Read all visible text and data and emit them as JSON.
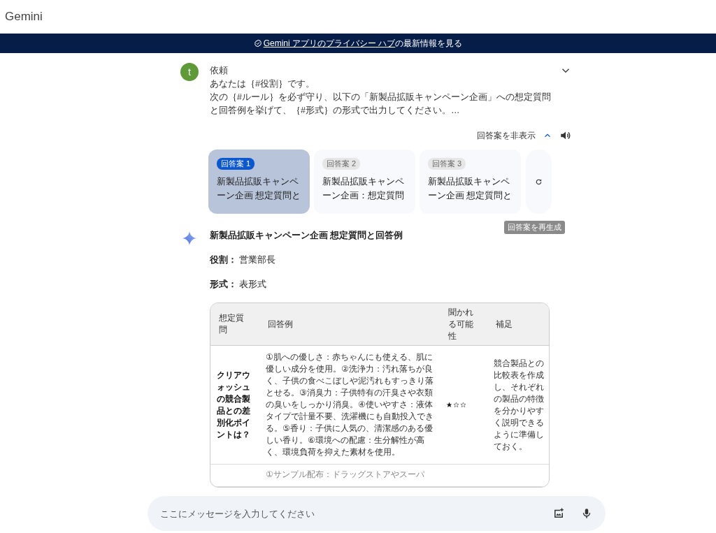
{
  "app": {
    "title": "Gemini"
  },
  "banner": {
    "link": "Gemini アプリのプライバシー ハブ",
    "text": "の最新情報を見る"
  },
  "prompt": {
    "avatar": "t",
    "title": "依頼",
    "expanded": false,
    "lines": [
      "あなたは｛#役割｝です。",
      "次の｛#ルール｝を必ず守り、以下の「新製品拡販キャンペーン企画」への想定質問と回答例を挙げて、｛#形式｝の形式で出力してください。…"
    ]
  },
  "drafts": {
    "toggle_label": "回答案を非表示",
    "expanded": true,
    "regenerate_tooltip": "回答案を再生成",
    "items": [
      {
        "badge": "回答案 1",
        "lines": [
          "新製品拡販キャンペ",
          "ーン企画 想定質問と"
        ],
        "selected": true
      },
      {
        "badge": "回答案 2",
        "lines": [
          "新製品拡販キャンペ",
          "ーン企画：想定質問"
        ],
        "selected": false
      },
      {
        "badge": "回答案 3",
        "lines": [
          "新製品拡販キャンペ",
          "ーン企画 想定質問と"
        ],
        "selected": false
      }
    ]
  },
  "response": {
    "title": "新製品拡販キャンペーン企画 想定質問と回答例",
    "fields": [
      "**役割：** 営業部長",
      "**形式：** 表形式"
    ],
    "table": {
      "columns": [
        "想定質問",
        "回答例",
        "聞かれる可能性",
        "補足"
      ],
      "rows": [
        {
          "question": "クリアウォッシュの競合製品との差別化ポイントは？",
          "answer": "①肌への優しさ：赤ちゃんにも使える、肌に優しい成分を使用。②洗浄力：汚れ落ちが良く、子供の食べこぼしや泥汚れもすっきり落とせる。③消臭力：子供特有の汗臭さや衣類の臭いをしっかり消臭。④使いやすさ：液体タイプで計量不要、洗濯機にも自動投入できる。⑤香り：子供に人気の、清潔感のある優しい香り。⑥環境への配慮：生分解性が高く、環境負荷を抑えた素材を使用。",
          "stars": 1,
          "note": "競合製品との比較表を作成し、それぞれの製品の特徴を分かりやすく説明できるように準備しておく。"
        },
        {
          "answer": "①サンプル配布：ドラッグストアやスーパ"
        }
      ]
    }
  },
  "input": {
    "placeholder": "ここにメッセージを入力してください"
  }
}
